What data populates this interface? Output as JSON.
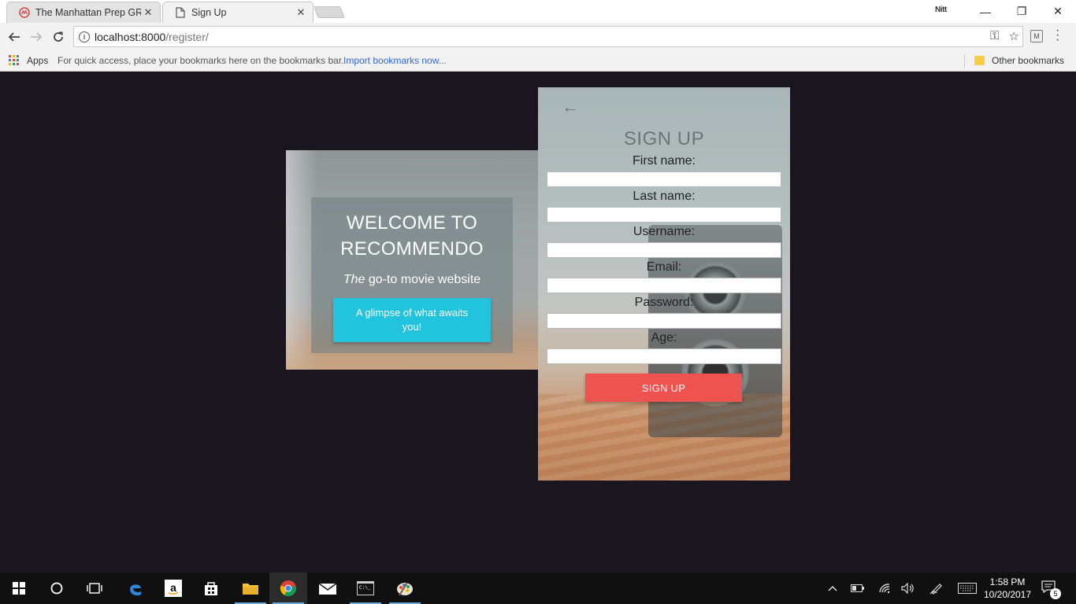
{
  "browser": {
    "tabs": [
      {
        "title": "The Manhattan Prep GRE",
        "active": false
      },
      {
        "title": "Sign Up",
        "active": true
      }
    ],
    "profile_badge": "Nitt",
    "window_controls": {
      "minimize": "—",
      "maximize": "❐",
      "close": "✕"
    },
    "url_host": "localhost:8000",
    "url_path": "/register/",
    "bookmarks": {
      "apps_label": "Apps",
      "hint": "For quick access, place your bookmarks here on the bookmarks bar.",
      "import_link": "Import bookmarks now...",
      "other": "Other bookmarks"
    }
  },
  "welcome": {
    "title_line1": "WELCOME TO",
    "title_line2": "RECOMMENDO",
    "subtitle_em": "The",
    "subtitle_rest": " go-to movie website",
    "button_label": "A glimpse of what awaits you!",
    "button_color": "#22c3dc"
  },
  "signup": {
    "back_arrow": "←",
    "title": "SIGN UP",
    "fields": [
      {
        "label": "First name:",
        "value": ""
      },
      {
        "label": "Last name:",
        "value": ""
      },
      {
        "label": "Username:",
        "value": ""
      },
      {
        "label": "Email:",
        "value": ""
      },
      {
        "label": "Password:",
        "value": ""
      },
      {
        "label": "Age:",
        "value": ""
      }
    ],
    "submit_label": "SIGN UP",
    "submit_color": "#ef5350"
  },
  "taskbar": {
    "time": "1:58 PM",
    "date": "10/20/2017",
    "notifications": "5",
    "pinned_icons": [
      "windows-start-icon",
      "cortana-icon",
      "task-view-icon",
      "edge-icon",
      "amazon-icon",
      "store-icon",
      "file-explorer-icon",
      "chrome-icon",
      "mail-icon",
      "terminal-icon",
      "paint-icon"
    ]
  }
}
